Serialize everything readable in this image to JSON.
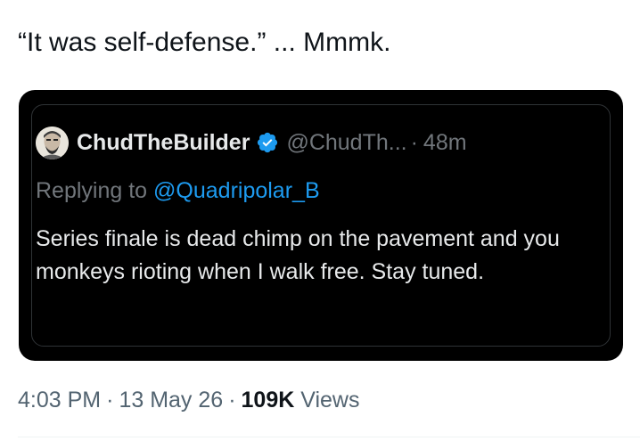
{
  "tweet": {
    "text": "“It was self-defense.” ... Mmmk."
  },
  "quoted_tweet": {
    "display_name": "ChudTheBuilder",
    "handle": "@ChudTh...",
    "time_ago": "48m",
    "replying_prefix": "Replying to ",
    "replying_handle": "@Quadripolar_B",
    "body": "Series finale is dead chimp on the pavement and you monkeys rioting when I walk free. Stay tuned.",
    "verified_color": "#1d9bf0"
  },
  "meta": {
    "time": "4:03 PM",
    "date": "13 May 26",
    "views_count": "109K",
    "views_label": "Views"
  }
}
